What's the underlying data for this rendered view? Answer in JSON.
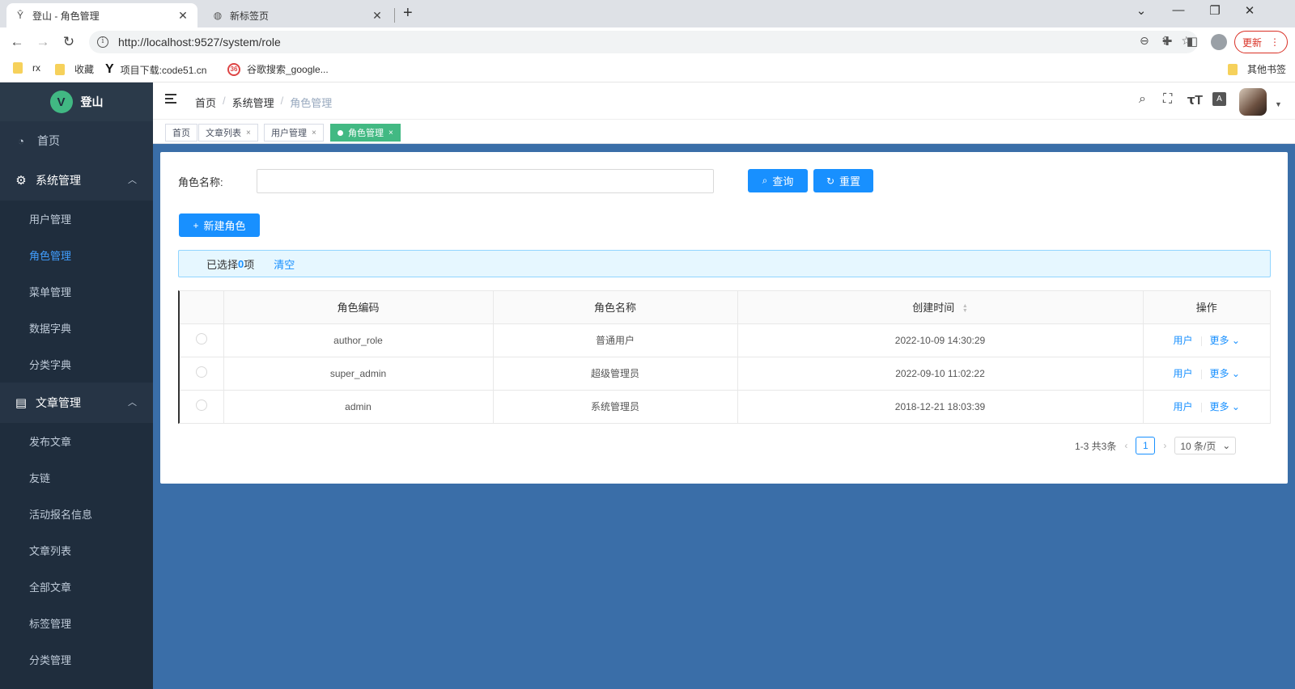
{
  "browser": {
    "tabs": [
      {
        "title": "登山 - 角色管理",
        "favicon": "tree-icon"
      },
      {
        "title": "新标签页",
        "favicon": "globe-icon"
      }
    ],
    "url": "http://localhost:9527/system/role",
    "update_label": "更新",
    "bookmarks": [
      {
        "label": "rx",
        "icon": "folder-icon"
      },
      {
        "label": "收藏",
        "icon": "folder-icon"
      },
      {
        "label": "项目下载:code51.cn",
        "icon": "y-logo-icon"
      },
      {
        "label": "谷歌搜索_google...",
        "icon": "360-icon"
      }
    ],
    "other_bookmarks": "其他书签"
  },
  "app": {
    "logo_text": "登山",
    "logo_letter": "V"
  },
  "sidebar": {
    "home": "首页",
    "groups": [
      {
        "label": "系统管理",
        "items": [
          "用户管理",
          "角色管理",
          "菜单管理",
          "数据字典",
          "分类字典"
        ]
      },
      {
        "label": "文章管理",
        "items": [
          "发布文章",
          "友链",
          "活动报名信息",
          "文章列表",
          "全部文章",
          "标签管理",
          "分类管理"
        ]
      }
    ],
    "active_item": "角色管理"
  },
  "breadcrumb": [
    "首页",
    "系统管理",
    "角色管理"
  ],
  "tags": [
    {
      "label": "首页",
      "closable": false
    },
    {
      "label": "文章列表",
      "closable": true
    },
    {
      "label": "用户管理",
      "closable": true
    },
    {
      "label": "角色管理",
      "closable": true,
      "active": true
    }
  ],
  "search": {
    "label": "角色名称:",
    "value": "",
    "query_button": "查询",
    "reset_button": "重置"
  },
  "toolbar": {
    "new_role_button": "新建角色"
  },
  "selection": {
    "prefix": "已选择",
    "count": "0",
    "suffix": "项",
    "clear": "清空"
  },
  "table": {
    "columns": [
      "角色编码",
      "角色名称",
      "创建时间",
      "操作"
    ],
    "rows": [
      {
        "code": "author_role",
        "name": "普通用户",
        "created": "2022-10-09 14:30:29"
      },
      {
        "code": "super_admin",
        "name": "超级管理员",
        "created": "2022-09-10 11:02:22"
      },
      {
        "code": "admin",
        "name": "系统管理员",
        "created": "2018-12-21 18:03:39"
      }
    ],
    "action_user": "用户",
    "action_more": "更多"
  },
  "pagination": {
    "summary": "1-3 共3条",
    "current_page": "1",
    "page_size": "10 条/页"
  },
  "colors": {
    "sidebar_bg": "#1f2d3d",
    "accent": "#1890ff",
    "active_tag": "#42b983",
    "page_bg": "#3a6ea8"
  }
}
